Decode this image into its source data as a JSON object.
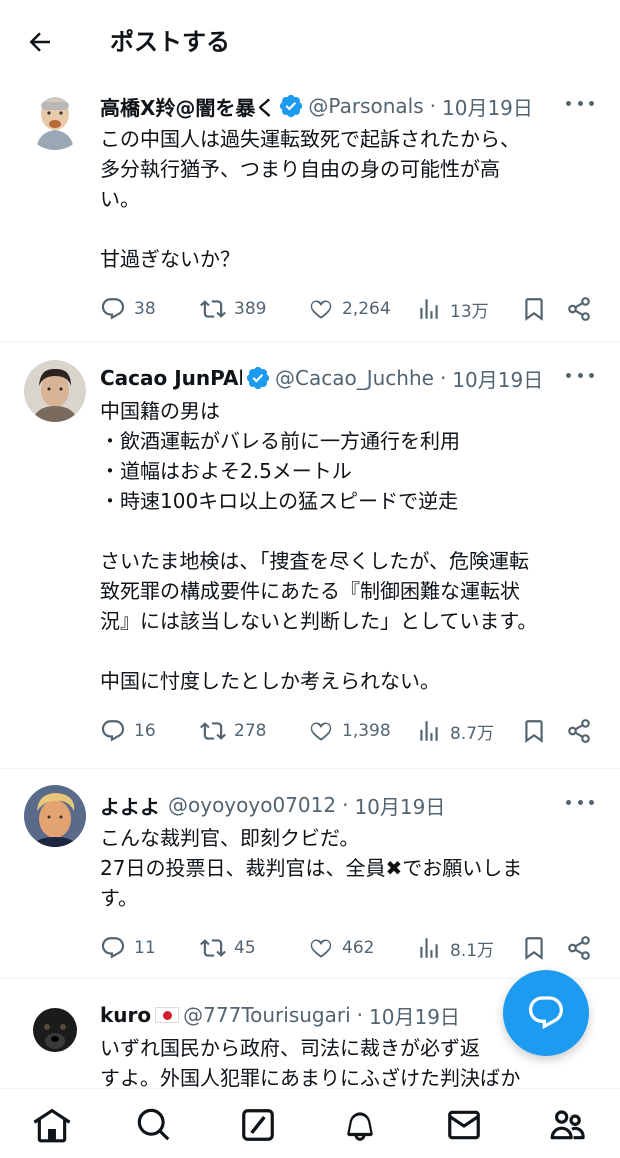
{
  "header": {
    "title": "ポストする"
  },
  "posts": [
    {
      "name": "高橋X羚@闇を暴く",
      "verified": true,
      "handle": "@Parsonals",
      "date": "10月19日",
      "text": "この中国人は過失運転致死で起訴されたから、\n多分執行猶予、つまり自由の身の可能性が高\nい。\n\n甘過ぎないか？",
      "replies": "38",
      "reposts": "389",
      "likes": "2,264",
      "views": "13万"
    },
    {
      "name": "Cacao JunPAk",
      "verified": true,
      "handle": "@Cacao_Juchhe",
      "date": "10月19日",
      "text": "中国籍の男は\n・飲酒運転がバレる前に一方通行を利用\n・道幅はおよそ2.5メートル\n・時速100キロ以上の猛スピードで逆走\n\nさいたま地検は、「捜査を尽くしたが、危険運転\n致死罪の構成要件にあたる『制御困難な運転状\n況』には該当しないと判断した」としています。\n\n中国に忖度したとしか考えられない。",
      "replies": "16",
      "reposts": "278",
      "likes": "1,398",
      "views": "8.7万"
    },
    {
      "name": "よよよ",
      "verified": false,
      "handle": "@oyoyoyo07012",
      "date": "10月19日",
      "text_before": "こんな裁判官、即刻クビだ。\n27日の投票日、裁判官は、全員",
      "text_mark": "✖",
      "text_after": "でお願いしま\nす。",
      "replies": "11",
      "reposts": "45",
      "likes": "462",
      "views": "8.1万"
    },
    {
      "name": "kuro",
      "verified": false,
      "handle": "@777Tourisugari",
      "date": "10月19日",
      "text": "いずれ国民から政府、司法に裁きが必ず返\nすよ。外国人犯罪にあまりにふざけた判決ばか"
    }
  ],
  "icons": {
    "back": "arrow-left-icon",
    "more": "more-horizontal-icon",
    "reply": "reply-bubble-icon",
    "repost": "repost-icon",
    "like": "heart-icon",
    "views": "analytics-bars-icon",
    "bookmark": "bookmark-icon",
    "share": "share-icon",
    "verified": "verified-badge-icon",
    "compose": "compose-reply-icon",
    "home": "home-icon",
    "search": "search-icon",
    "grok": "grok-slash-icon",
    "notifications": "bell-icon",
    "messages": "mail-icon",
    "communities": "communities-icon"
  },
  "colors": {
    "accent": "#1d9bf0",
    "text": "#0f1419",
    "muted": "#536471"
  }
}
